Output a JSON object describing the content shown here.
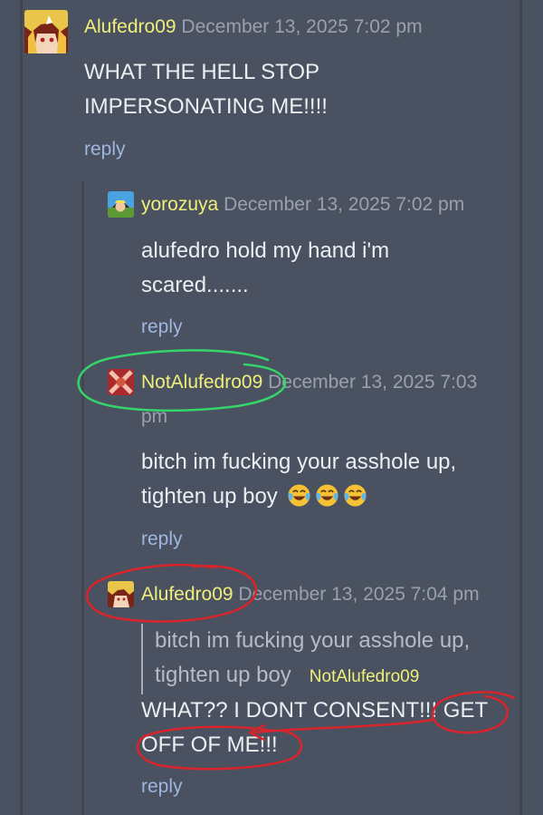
{
  "comments": [
    {
      "username": "Alufedro09",
      "date": "December 13, 2025 7:02 pm",
      "body": "WHAT THE HELL STOP IMPERSONATING ME!!!!",
      "reply_label": "reply"
    },
    {
      "username": "yorozuya",
      "date": "December 13, 2025 7:02 pm",
      "body": "alufedro hold my hand i'm scared.......",
      "reply_label": "reply"
    },
    {
      "username": "NotAlufedro09",
      "date": "December 13, 2025 7:03 pm",
      "body": "bitch im fucking your asshole up, tighten up boy",
      "emojis": [
        "face-with-tears-of-joy",
        "face-with-tears-of-joy",
        "face-with-tears-of-joy"
      ],
      "reply_label": "reply"
    },
    {
      "username": "Alufedro09",
      "date": "December 13, 2025 7:04 pm",
      "quote": {
        "text": "bitch im fucking your asshole up, tighten up boy",
        "author": "NotAlufedro09"
      },
      "body": "WHAT?? I DONT CONSENT!!! GET OFF OF ME!!!",
      "reply_label": "reply"
    }
  ],
  "colors": {
    "background": "#4a5160",
    "username": "#f0ef7a",
    "date": "#9aa1ae",
    "body": "#eceef2",
    "reply": "#9fb6e0",
    "annotation_green": "#34d66a",
    "annotation_red": "#d8242a"
  }
}
